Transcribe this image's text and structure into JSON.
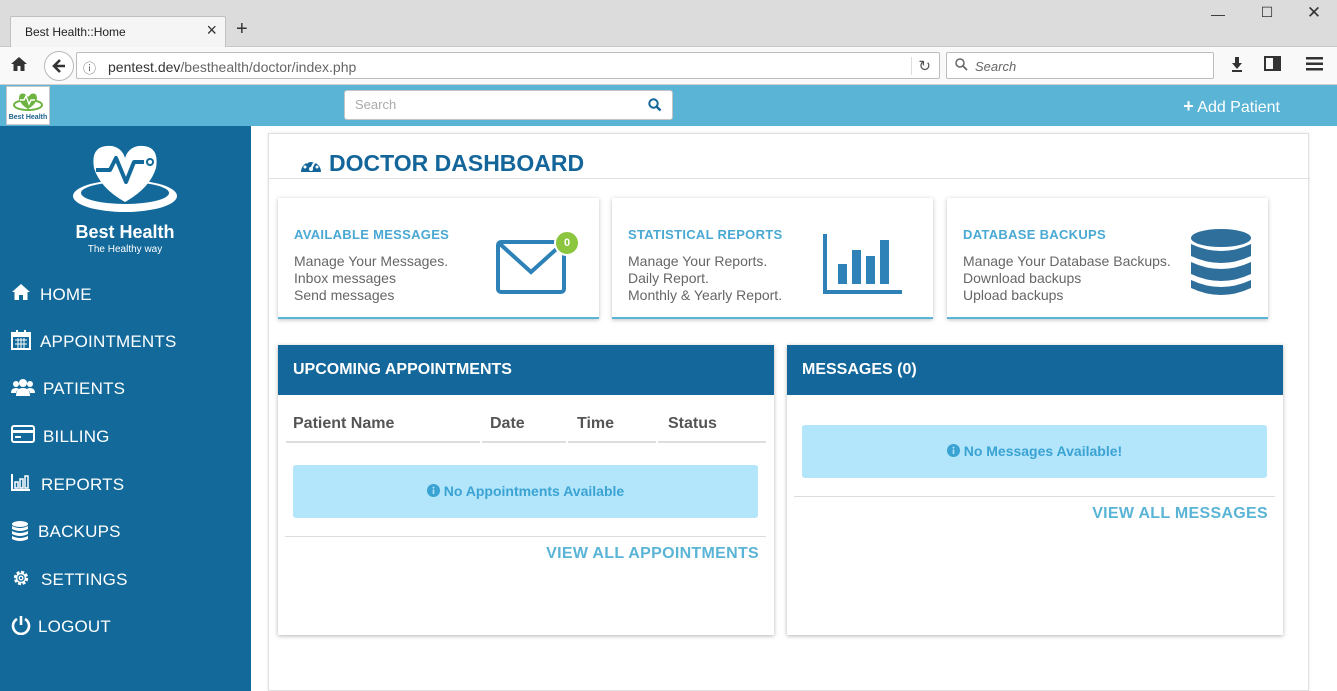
{
  "browser": {
    "tab_title": "Best Health::Home",
    "url_host": "pentest.dev",
    "url_path": "/besthealth/doctor/index.php",
    "search_placeholder": "Search"
  },
  "header": {
    "search_placeholder": "Search",
    "add_patient_label": "Add Patient",
    "logo_text": "Best Health"
  },
  "brand": {
    "name": "Best Health",
    "tagline": "The Healthy way"
  },
  "sidebar": {
    "items": [
      {
        "label": "HOME",
        "icon": "home-icon"
      },
      {
        "label": "APPOINTMENTS",
        "icon": "calendar-icon"
      },
      {
        "label": "PATIENTS",
        "icon": "users-icon"
      },
      {
        "label": "BILLING",
        "icon": "credit-card-icon"
      },
      {
        "label": "REPORTS",
        "icon": "bar-chart-icon"
      },
      {
        "label": "BACKUPS",
        "icon": "database-icon"
      },
      {
        "label": "SETTINGS",
        "icon": "gear-icon"
      },
      {
        "label": "LOGOUT",
        "icon": "power-icon"
      }
    ]
  },
  "main": {
    "title": "DOCTOR DASHBOARD",
    "cards": [
      {
        "title": "AVAILABLE MESSAGES",
        "lines": [
          "Manage Your Messages.",
          "Inbox messages",
          "Send messages"
        ],
        "badge": "0"
      },
      {
        "title": "STATISTICAL REPORTS",
        "lines": [
          "Manage Your Reports.",
          "Daily Report.",
          "Monthly & Yearly Report."
        ]
      },
      {
        "title": "DATABASE BACKUPS",
        "lines": [
          "Manage Your Database Backups.",
          "Download backups",
          "Upload backups"
        ]
      }
    ],
    "appointments": {
      "title": "UPCOMING APPOINTMENTS",
      "columns": [
        "Patient Name",
        "Date",
        "Time",
        "Status"
      ],
      "empty_text": "No Appointments Available",
      "view_all": "VIEW ALL APPOINTMENTS"
    },
    "messages": {
      "title": "MESSAGES (0)",
      "empty_text": "No Messages Available!",
      "view_all": "VIEW ALL MESSAGES"
    }
  },
  "colors": {
    "sidebar": "#12699a",
    "header": "#5ab4d6",
    "accent": "#4aa9d3",
    "alert_bg": "#b3e5fb"
  }
}
